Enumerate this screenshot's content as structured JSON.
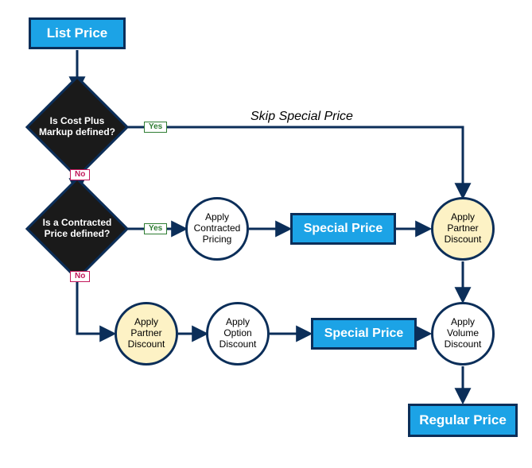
{
  "colors": {
    "brand_fill": "#1ca3e6",
    "border": "#0b2e59",
    "diamond_fill": "#1a1a1a",
    "highlight_fill": "#fdf2c5",
    "yes": "#2e7d32",
    "no": "#c2185b"
  },
  "nodes": {
    "list_price": "List Price",
    "is_cost_plus": "Is Cost Plus Markup defined?",
    "is_contracted": "Is a Contracted Price defined?",
    "apply_contracted": "Apply Contracted Pricing",
    "special_price_1": "Special Price",
    "apply_partner_1": "Apply Partner Discount",
    "apply_partner_2": "Apply Partner Discount",
    "apply_option": "Apply Option Discount",
    "special_price_2": "Special Price",
    "apply_volume": "Apply Volume Discount",
    "regular_price": "Regular Price"
  },
  "edge_labels": {
    "yes1": "Yes",
    "no1": "No",
    "yes2": "Yes",
    "no2": "No"
  },
  "annotations": {
    "skip_special": "Skip Special Price"
  }
}
